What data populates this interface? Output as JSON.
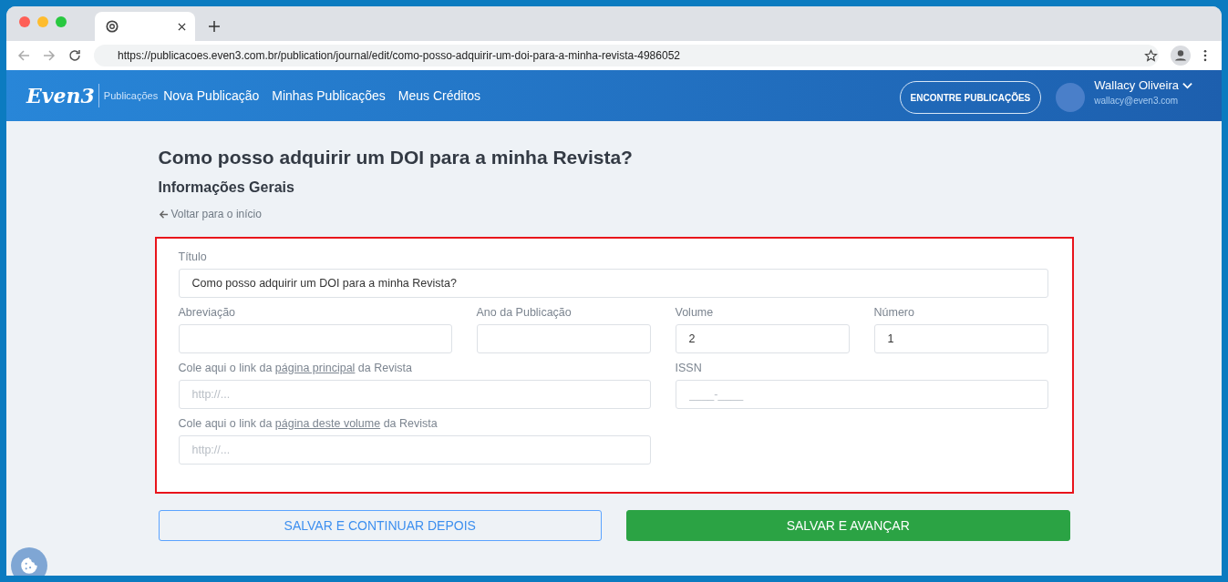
{
  "browser": {
    "url": "https://publicacoes.even3.com.br/publication/journal/edit/como-posso-adquirir-um-doi-para-a-minha-revista-4986052"
  },
  "header": {
    "logo": "Even3",
    "logo_sub": "Publicações",
    "nav": [
      "Nova Publicação",
      "Minhas Publicações",
      "Meus Créditos"
    ],
    "find_button": "ENCONTRE PUBLICAÇÕES",
    "user_name": "Wallacy Oliveira",
    "user_email": "wallacy@even3.com"
  },
  "page": {
    "title": "Como posso adquirir um DOI para a minha Revista?",
    "subtitle": "Informações Gerais",
    "back_link": "Voltar para o início"
  },
  "form": {
    "titulo": {
      "label": "Título",
      "value": "Como posso adquirir um DOI para a minha Revista?"
    },
    "abreviacao": {
      "label": "Abreviação"
    },
    "ano": {
      "label": "Ano da Publicação"
    },
    "volume": {
      "label": "Volume",
      "value": "2"
    },
    "numero": {
      "label": "Número",
      "value": "1"
    },
    "link_principal": {
      "label_before": "Cole aqui o link da",
      "label_link": "página principal",
      "label_after": "da Revista",
      "placeholder": "http://..."
    },
    "issn": {
      "label": "ISSN",
      "placeholder": "____-____"
    },
    "link_volume": {
      "label_before": "Cole aqui o link da",
      "label_link": "página deste volume",
      "label_after": "da Revista",
      "placeholder": "http://..."
    }
  },
  "buttons": {
    "save_later": "SALVAR E CONTINUAR DEPOIS",
    "save_next": "SALVAR E AVANÇAR"
  }
}
